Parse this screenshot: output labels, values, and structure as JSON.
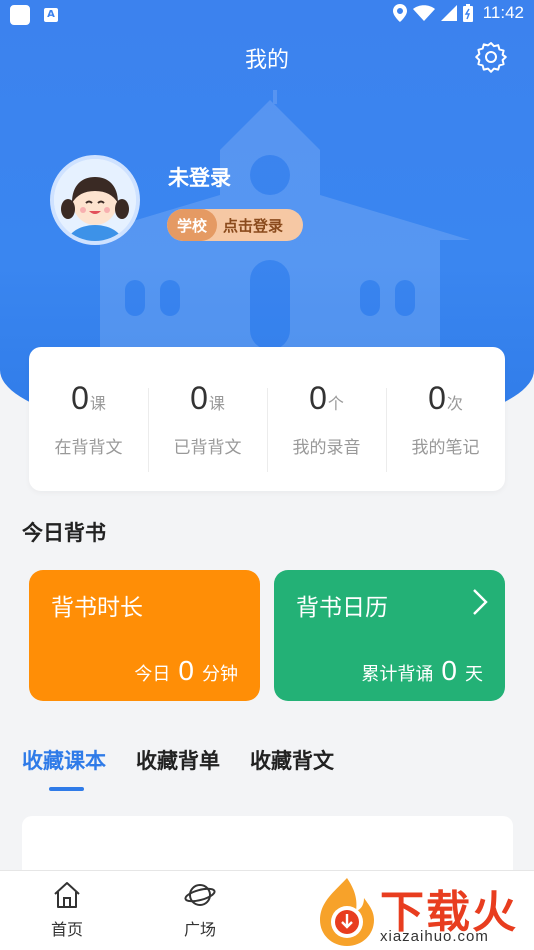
{
  "status_bar": {
    "time": "11:42"
  },
  "header": {
    "title": "我的"
  },
  "profile": {
    "username": "未登录",
    "school_label": "学校",
    "login_label": "点击登录"
  },
  "stats": [
    {
      "value": "0",
      "unit": "课",
      "label": "在背背文"
    },
    {
      "value": "0",
      "unit": "课",
      "label": "已背背文"
    },
    {
      "value": "0",
      "unit": "个",
      "label": "我的录音"
    },
    {
      "value": "0",
      "unit": "次",
      "label": "我的笔记"
    }
  ],
  "today": {
    "section_title": "今日背书",
    "duration_card": {
      "title": "背书时长",
      "prefix": "今日",
      "value": "0",
      "unit": "分钟",
      "color": "#ff8e06"
    },
    "calendar_card": {
      "title": "背书日历",
      "prefix": "累计背诵",
      "value": "0",
      "unit": "天",
      "color": "#23b176"
    }
  },
  "tabs": [
    {
      "label": "收藏课本",
      "active": true
    },
    {
      "label": "收藏背单",
      "active": false
    },
    {
      "label": "收藏背文",
      "active": false
    }
  ],
  "bottom_nav": [
    {
      "label": "首页",
      "icon": "home-icon"
    },
    {
      "label": "广场",
      "icon": "planet-icon"
    }
  ],
  "watermark": {
    "text": "下载火",
    "url": "xiazaihuo.com"
  },
  "colors": {
    "primary": "#2f7be8",
    "hero": "#3c82ee"
  }
}
